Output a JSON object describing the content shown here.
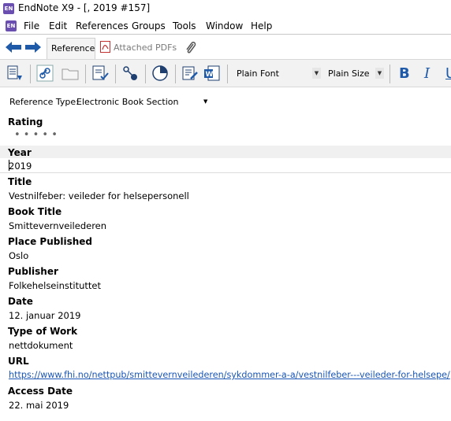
{
  "window": {
    "logo": "EN",
    "title": "EndNote X9 - [, 2019 #157]"
  },
  "menubar": {
    "logo": "EN",
    "items": [
      "File",
      "Edit",
      "References",
      "Groups",
      "Tools",
      "Window",
      "Help"
    ]
  },
  "tabs": {
    "reference": "Reference",
    "attached_pdfs": "Attached PDFs"
  },
  "toolbar": {
    "font": "Plain Font",
    "size": "Plain Size",
    "bold": "B",
    "italic": "I",
    "underline": "U"
  },
  "reference_type": {
    "label": "Reference Type:",
    "value": "Electronic Book Section"
  },
  "fields": {
    "rating": {
      "label": "Rating",
      "dots": "• • • • •"
    },
    "year": {
      "label": "Year",
      "value": "2019"
    },
    "title": {
      "label": "Title",
      "value": "Vestnilfeber: veileder for helsepersonell"
    },
    "book_title": {
      "label": "Book Title",
      "value": "Smittevernveilederen"
    },
    "place_published": {
      "label": "Place Published",
      "value": "Oslo"
    },
    "publisher": {
      "label": "Publisher",
      "value": "Folkehelseinstituttet"
    },
    "date": {
      "label": "Date",
      "value": "12. januar 2019"
    },
    "type_of_work": {
      "label": "Type of Work",
      "value": "nettdokument"
    },
    "url": {
      "label": "URL",
      "value": "https://www.fhi.no/nettpub/smittevernveilederen/sykdommer-a-a/vestnilfeber---veileder-for-helsepe/"
    },
    "access_date": {
      "label": "Access Date",
      "value": "22. mai 2019"
    }
  },
  "colors": {
    "accent": "#1f5aa8",
    "link": "#1a56b6",
    "logo": "#6a4fb0",
    "pdf_red": "#c23030"
  }
}
